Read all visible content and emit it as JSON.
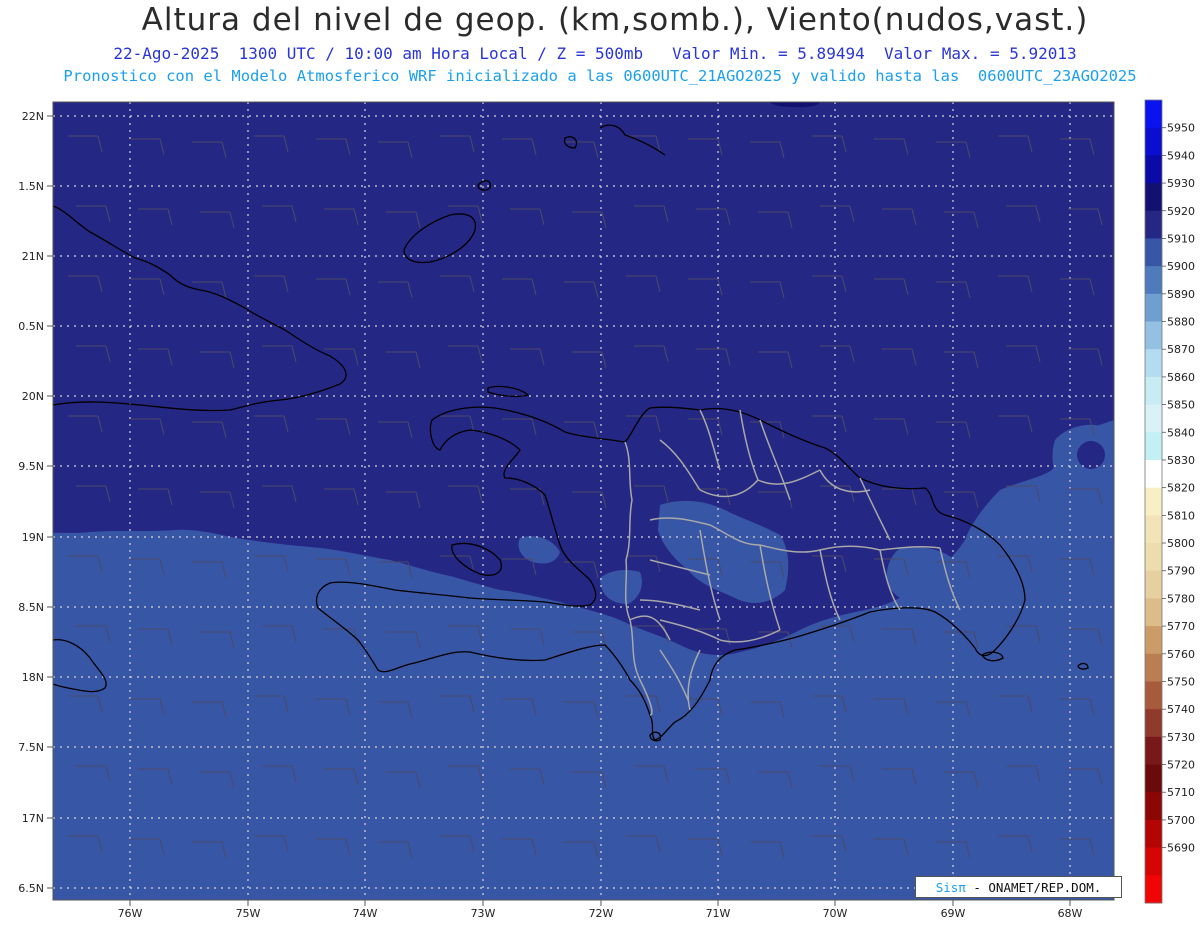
{
  "header": {
    "title": "Altura del nivel de geop. (km,somb.), Viento(nudos,vast.)",
    "subtitle": "22-Ago-2025  1300 UTC / 10:00 am Hora Local / Z = 500mb   Valor Min. = 5.89494  Valor Max. = 5.92013",
    "model_info": "Pronostico con el Modelo Atmosferico WRF inicializado a las 0600UTC_21AGO2025 y valido hasta las  0600UTC_23AGO2025"
  },
  "map": {
    "lat_labels": [
      "22N",
      "1.5N",
      "21N",
      "0.5N",
      "20N",
      "9.5N",
      "19N",
      "8.5N",
      "18N",
      "7.5N",
      "17N",
      "6.5N"
    ],
    "lon_labels": [
      "76W",
      "75W",
      "74W",
      "73W",
      "72W",
      "71W",
      "70W",
      "69W",
      "68W"
    ],
    "colors": {
      "band_5910": "#252784",
      "band_5900": "#3856a6",
      "band_5890": "#4f7bbd",
      "band_5880": "#6f9fd0",
      "coast": "#000000",
      "provinces": "#a8a8a8"
    }
  },
  "colorbar": {
    "labels": [
      "5950",
      "5940",
      "5930",
      "5920",
      "5910",
      "5900",
      "5890",
      "5880",
      "5870",
      "5860",
      "5850",
      "5840",
      "5830",
      "5820",
      "5810",
      "5800",
      "5790",
      "5780",
      "5770",
      "5760",
      "5750",
      "5740",
      "5730",
      "5720",
      "5710",
      "5700",
      "5690"
    ],
    "colors": [
      "#0a12f0",
      "#0a0ed0",
      "#0a0aa8",
      "#121070",
      "#252784",
      "#3856a6",
      "#4f7bbd",
      "#6f9fd0",
      "#93c0e3",
      "#b3dcf0",
      "#c8ecf4",
      "#d8f2f8",
      "#c3f0f4",
      "#ffffff",
      "#f8efc4",
      "#f2e4b8",
      "#ecdcae",
      "#e6d0a0",
      "#dcbc88",
      "#cc9c68",
      "#bb7e52",
      "#a85a3c",
      "#8f3a2a",
      "#781818",
      "#6a0a0a",
      "#8c0606",
      "#b40404",
      "#d60404",
      "#f00404"
    ]
  },
  "credit": {
    "brand": "Sisπ",
    "rest": " - ONAMET/REP.DOM."
  }
}
